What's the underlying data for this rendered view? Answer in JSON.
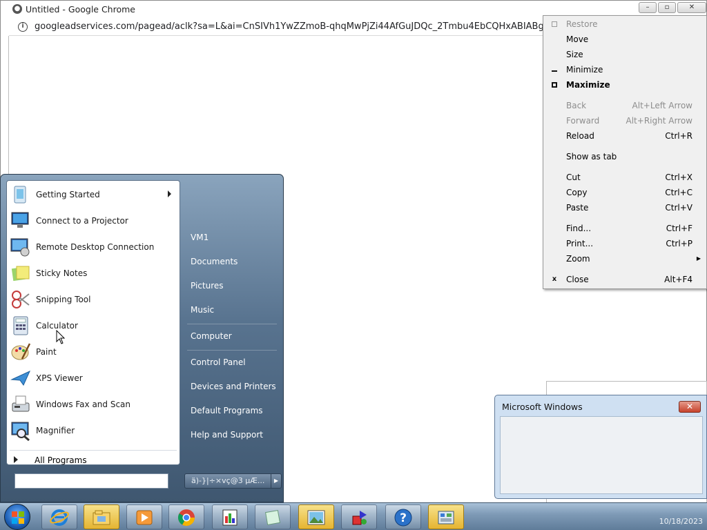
{
  "browser": {
    "window_title": "Untitled - Google Chrome",
    "url": "googleadservices.com/pagead/aclk?sa=L&ai=CnSIVh1YwZZmoB-qhqMwPjZi44AfGuJDQc_2Tmbu4EbCQHxABIABgycapi",
    "window_buttons": [
      "–",
      "▫",
      "✕"
    ]
  },
  "context_menu": {
    "items": [
      {
        "label": "Restore",
        "shortcut": "",
        "disabled": true
      },
      {
        "label": "Move",
        "shortcut": ""
      },
      {
        "label": "Size",
        "shortcut": ""
      },
      {
        "label": "Minimize",
        "shortcut": ""
      },
      {
        "label": "Maximize",
        "shortcut": "",
        "bold": true
      },
      {
        "label": "Back",
        "shortcut": "Alt+Left Arrow",
        "disabled": true
      },
      {
        "label": "Forward",
        "shortcut": "Alt+Right Arrow",
        "disabled": true
      },
      {
        "label": "Reload",
        "shortcut": "Ctrl+R"
      },
      {
        "label": "Show as tab",
        "shortcut": ""
      },
      {
        "label": "Cut",
        "shortcut": "Ctrl+X"
      },
      {
        "label": "Copy",
        "shortcut": "Ctrl+C"
      },
      {
        "label": "Paste",
        "shortcut": "Ctrl+V"
      },
      {
        "label": "Find...",
        "shortcut": "Ctrl+F"
      },
      {
        "label": "Print...",
        "shortcut": "Ctrl+P"
      },
      {
        "label": "Zoom",
        "shortcut": ""
      },
      {
        "label": "Close",
        "shortcut": "Alt+F4"
      }
    ]
  },
  "start_menu": {
    "programs": [
      {
        "label": "Getting Started",
        "icon": "getting-started-icon"
      },
      {
        "label": "Connect to a Projector",
        "icon": "projector-icon"
      },
      {
        "label": "Remote Desktop Connection",
        "icon": "remote-desktop-icon"
      },
      {
        "label": "Sticky Notes",
        "icon": "sticky-notes-icon"
      },
      {
        "label": "Snipping Tool",
        "icon": "snipping-tool-icon"
      },
      {
        "label": "Calculator",
        "icon": "calculator-icon"
      },
      {
        "label": "Paint",
        "icon": "paint-icon"
      },
      {
        "label": "XPS Viewer",
        "icon": "xps-viewer-icon"
      },
      {
        "label": "Windows Fax and Scan",
        "icon": "fax-scan-icon"
      },
      {
        "label": "Magnifier",
        "icon": "magnifier-icon"
      }
    ],
    "all_programs": "All Programs",
    "search_value": "",
    "places": [
      "VM1",
      "Documents",
      "Pictures",
      "Music",
      "Computer",
      "Control Panel",
      "Devices and Printers",
      "Default Programs",
      "Help and Support"
    ],
    "shutdown_label": "ä)-}|÷×vç@3 µÆ..."
  },
  "dialog": {
    "title": "Microsoft Windows",
    "close": "✕"
  },
  "taskbar": {
    "items": [
      "internet-explorer-icon",
      "windows-explorer-icon",
      "media-player-icon",
      "chrome-icon",
      "app-icon",
      "sticky-note-app-icon",
      "photo-viewer-icon",
      "shapes-app-icon",
      "help-icon",
      "control-panel-icon"
    ],
    "clock": "10/18/2023"
  }
}
